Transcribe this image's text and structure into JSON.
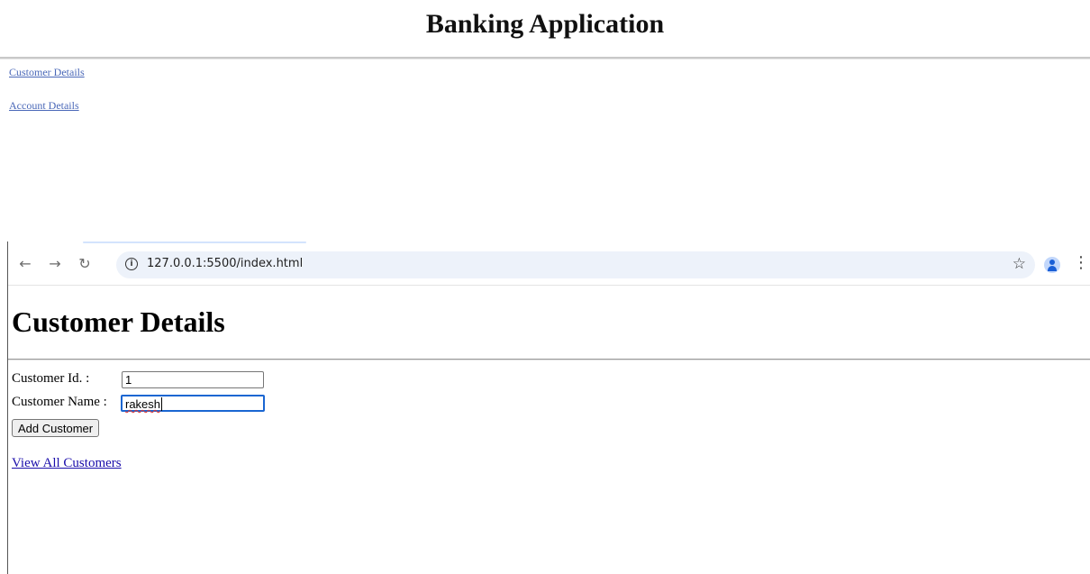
{
  "banking": {
    "title": "Banking Application",
    "links": [
      "Customer Details",
      "Account Details"
    ]
  },
  "browser": {
    "url": "127.0.0.1:5500/index.html",
    "icons": [
      "back-arrow-icon",
      "forward-arrow-icon",
      "reload-icon",
      "info-icon",
      "star-icon",
      "profile-avatar-icon",
      "more-menu-icon"
    ]
  },
  "page": {
    "heading": "Customer Details",
    "fields": [
      {
        "label": "Customer Id. :",
        "value": "1"
      },
      {
        "label": "Customer Name :",
        "value": "rakesh"
      }
    ],
    "add_button": "Add Customer",
    "view_all_link": "View All Customers"
  }
}
